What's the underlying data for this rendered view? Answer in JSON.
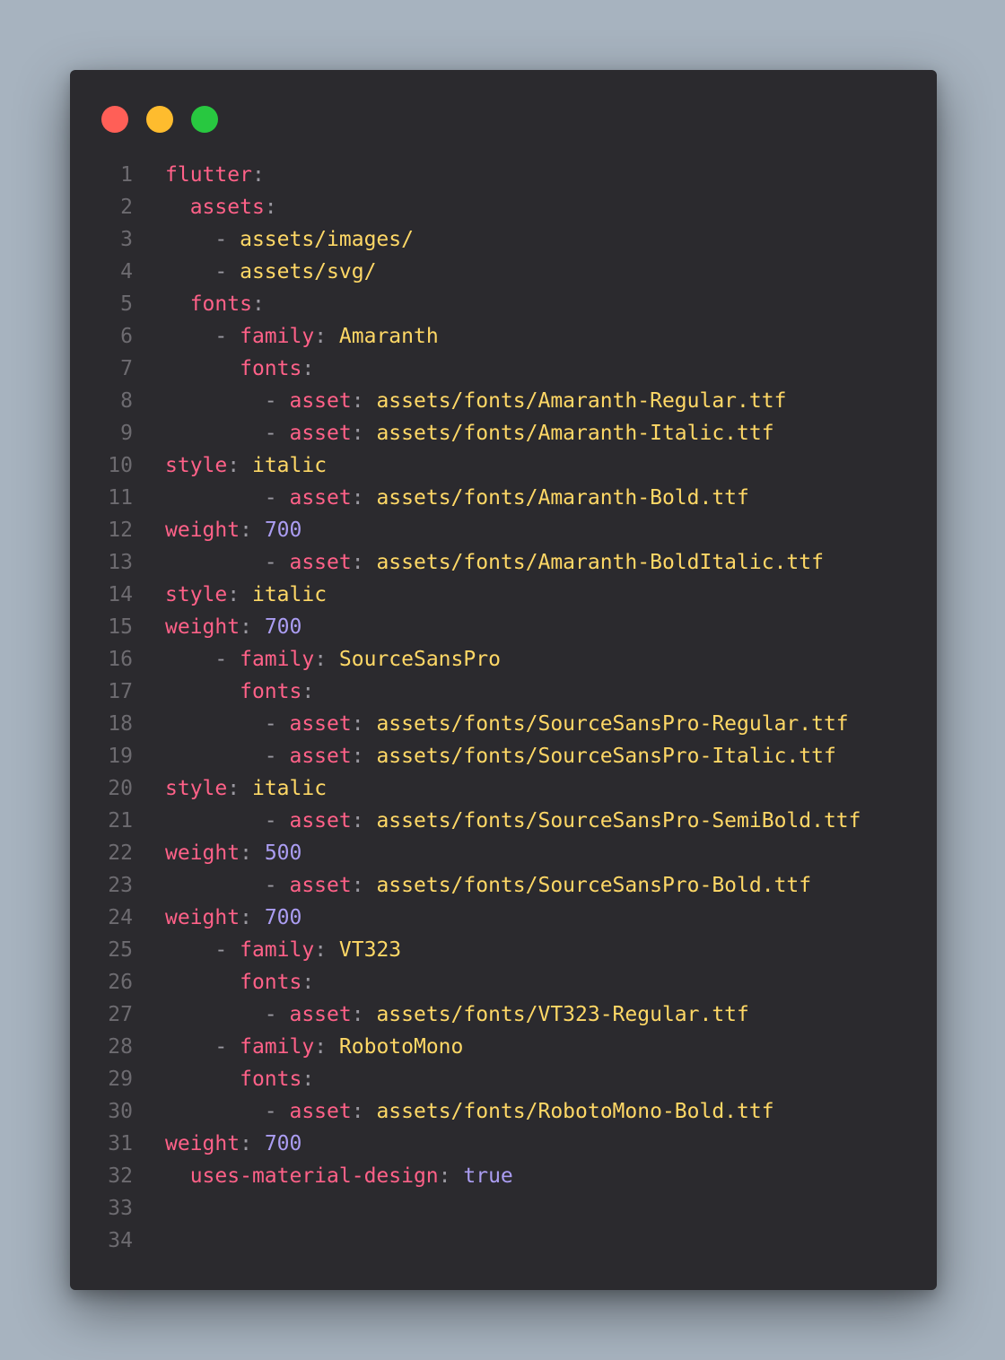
{
  "window": {
    "controls": [
      "close",
      "minimize",
      "maximize"
    ],
    "colors": {
      "close": "#ff5f57",
      "minimize": "#febc2e",
      "maximize": "#28c840",
      "background": "#2b2a2e"
    }
  },
  "syntax_colors": {
    "key": "#ff6188",
    "punctuation": "#9a98a0",
    "string": "#ffd866",
    "number": "#ab9df2",
    "line_number": "#6d6b70"
  },
  "lines": [
    {
      "num": "1",
      "indent": "",
      "dash": "",
      "key": "flutter",
      "colon": ":",
      "value": "",
      "value_type": "string"
    },
    {
      "num": "2",
      "indent": "  ",
      "dash": "",
      "key": "assets",
      "colon": ":",
      "value": "",
      "value_type": "string"
    },
    {
      "num": "3",
      "indent": "    ",
      "dash": "- ",
      "key": "",
      "colon": "",
      "value": "assets/images/",
      "value_type": "string"
    },
    {
      "num": "4",
      "indent": "    ",
      "dash": "- ",
      "key": "",
      "colon": "",
      "value": "assets/svg/",
      "value_type": "string"
    },
    {
      "num": "5",
      "indent": "  ",
      "dash": "",
      "key": "fonts",
      "colon": ":",
      "value": "",
      "value_type": "string"
    },
    {
      "num": "6",
      "indent": "    ",
      "dash": "- ",
      "key": "family",
      "colon": ":",
      "value": "Amaranth",
      "value_type": "string"
    },
    {
      "num": "7",
      "indent": "      ",
      "dash": "",
      "key": "fonts",
      "colon": ":",
      "value": "",
      "value_type": "string"
    },
    {
      "num": "8",
      "indent": "        ",
      "dash": "- ",
      "key": "asset",
      "colon": ":",
      "value": "assets/fonts/Amaranth-Regular.ttf",
      "value_type": "string"
    },
    {
      "num": "9",
      "indent": "        ",
      "dash": "- ",
      "key": "asset",
      "colon": ":",
      "value": "assets/fonts/Amaranth-Italic.ttf",
      "value_type": "string"
    },
    {
      "num": "10",
      "indent": "",
      "dash": "",
      "key": "style",
      "colon": ":",
      "value": "italic",
      "value_type": "string"
    },
    {
      "num": "11",
      "indent": "        ",
      "dash": "- ",
      "key": "asset",
      "colon": ":",
      "value": "assets/fonts/Amaranth-Bold.ttf",
      "value_type": "string"
    },
    {
      "num": "12",
      "indent": "",
      "dash": "",
      "key": "weight",
      "colon": ":",
      "value": "700",
      "value_type": "number"
    },
    {
      "num": "13",
      "indent": "        ",
      "dash": "- ",
      "key": "asset",
      "colon": ":",
      "value": "assets/fonts/Amaranth-BoldItalic.ttf",
      "value_type": "string"
    },
    {
      "num": "14",
      "indent": "",
      "dash": "",
      "key": "style",
      "colon": ":",
      "value": "italic",
      "value_type": "string"
    },
    {
      "num": "15",
      "indent": "",
      "dash": "",
      "key": "weight",
      "colon": ":",
      "value": "700",
      "value_type": "number"
    },
    {
      "num": "16",
      "indent": "    ",
      "dash": "- ",
      "key": "family",
      "colon": ":",
      "value": "SourceSansPro",
      "value_type": "string"
    },
    {
      "num": "17",
      "indent": "      ",
      "dash": "",
      "key": "fonts",
      "colon": ":",
      "value": "",
      "value_type": "string"
    },
    {
      "num": "18",
      "indent": "        ",
      "dash": "- ",
      "key": "asset",
      "colon": ":",
      "value": "assets/fonts/SourceSansPro-Regular.ttf",
      "value_type": "string"
    },
    {
      "num": "19",
      "indent": "        ",
      "dash": "- ",
      "key": "asset",
      "colon": ":",
      "value": "assets/fonts/SourceSansPro-Italic.ttf",
      "value_type": "string"
    },
    {
      "num": "20",
      "indent": "",
      "dash": "",
      "key": "style",
      "colon": ":",
      "value": "italic",
      "value_type": "string"
    },
    {
      "num": "21",
      "indent": "        ",
      "dash": "- ",
      "key": "asset",
      "colon": ":",
      "value": "assets/fonts/SourceSansPro-SemiBold.ttf",
      "value_type": "string"
    },
    {
      "num": "22",
      "indent": "",
      "dash": "",
      "key": "weight",
      "colon": ":",
      "value": "500",
      "value_type": "number"
    },
    {
      "num": "23",
      "indent": "        ",
      "dash": "- ",
      "key": "asset",
      "colon": ":",
      "value": "assets/fonts/SourceSansPro-Bold.ttf",
      "value_type": "string"
    },
    {
      "num": "24",
      "indent": "",
      "dash": "",
      "key": "weight",
      "colon": ":",
      "value": "700",
      "value_type": "number"
    },
    {
      "num": "25",
      "indent": "    ",
      "dash": "- ",
      "key": "family",
      "colon": ":",
      "value": "VT323",
      "value_type": "string"
    },
    {
      "num": "26",
      "indent": "      ",
      "dash": "",
      "key": "fonts",
      "colon": ":",
      "value": "",
      "value_type": "string"
    },
    {
      "num": "27",
      "indent": "        ",
      "dash": "- ",
      "key": "asset",
      "colon": ":",
      "value": "assets/fonts/VT323-Regular.ttf",
      "value_type": "string"
    },
    {
      "num": "28",
      "indent": "    ",
      "dash": "- ",
      "key": "family",
      "colon": ":",
      "value": "RobotoMono",
      "value_type": "string"
    },
    {
      "num": "29",
      "indent": "      ",
      "dash": "",
      "key": "fonts",
      "colon": ":",
      "value": "",
      "value_type": "string"
    },
    {
      "num": "30",
      "indent": "        ",
      "dash": "- ",
      "key": "asset",
      "colon": ":",
      "value": "assets/fonts/RobotoMono-Bold.ttf",
      "value_type": "string"
    },
    {
      "num": "31",
      "indent": "",
      "dash": "",
      "key": "weight",
      "colon": ":",
      "value": "700",
      "value_type": "number"
    },
    {
      "num": "32",
      "indent": "  ",
      "dash": "",
      "key": "uses-material-design",
      "colon": ":",
      "value": "true",
      "value_type": "number"
    },
    {
      "num": "33",
      "indent": "",
      "dash": "",
      "key": "",
      "colon": "",
      "value": "",
      "value_type": "string"
    },
    {
      "num": "34",
      "indent": "",
      "dash": "",
      "key": "",
      "colon": "",
      "value": "",
      "value_type": "string"
    }
  ]
}
